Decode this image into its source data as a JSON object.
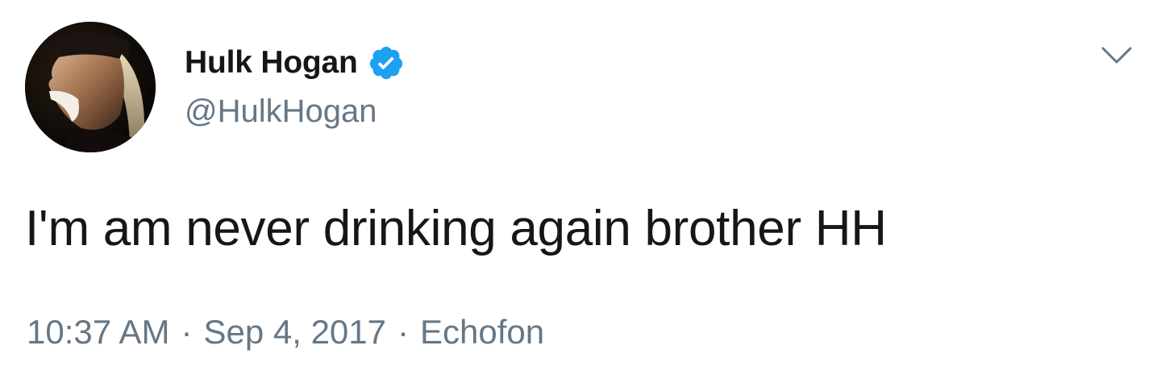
{
  "tweet": {
    "author": {
      "display_name": "Hulk Hogan",
      "handle": "@HulkHogan",
      "verified": true,
      "verified_color": "#1da1f2",
      "avatar_icon": "profile-photo"
    },
    "text": "I'm am never drinking again brother HH",
    "time": "10:37 AM",
    "date": "Sep 4, 2017",
    "source": "Echofon",
    "separator": "·",
    "menu_icon": "chevron-down-icon"
  },
  "colors": {
    "text_primary": "#14171a",
    "text_secondary": "#657786",
    "background": "#ffffff"
  }
}
